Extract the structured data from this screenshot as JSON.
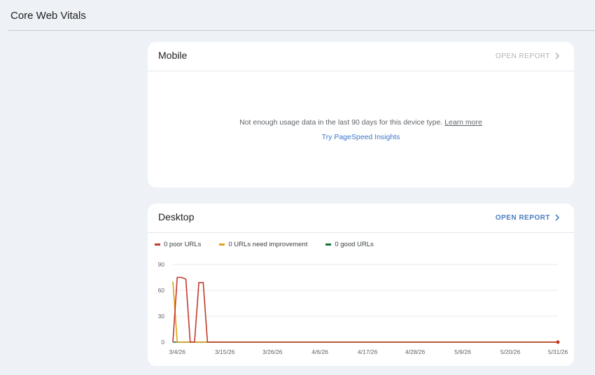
{
  "page": {
    "title": "Core Web Vitals"
  },
  "mobile": {
    "title": "Mobile",
    "open_report": "OPEN REPORT",
    "message": "Not enough usage data in the last 90 days for this device type.",
    "learn_more": "Learn more",
    "psi_link": "Try PageSpeed Insights"
  },
  "desktop": {
    "title": "Desktop",
    "open_report": "OPEN REPORT",
    "legend": {
      "poor": "0 poor URLs",
      "needs_improvement": "0 URLs need improvement",
      "good": "0 good URLs"
    }
  },
  "colors": {
    "poor": "#c0392b",
    "needs_improvement": "#e3a011",
    "good": "#137333",
    "link": "#4a7fc1"
  },
  "icons": {
    "open_report": "chevron-right-icon"
  },
  "chart_data": {
    "type": "line",
    "ylim": [
      0,
      90
    ],
    "yticks": [
      0,
      30,
      60,
      90
    ],
    "xrange": [
      "3/3/26",
      "5/31/26"
    ],
    "xtick_labels": [
      "3/4/26",
      "3/15/26",
      "3/26/26",
      "4/6/26",
      "4/17/26",
      "4/28/26",
      "5/9/26",
      "5/20/26",
      "5/31/26"
    ],
    "grid": true,
    "legend_position": "top-left",
    "series": [
      {
        "name": "0 poor URLs",
        "color": "#c0392b",
        "points": [
          [
            "3/3/26",
            0
          ],
          [
            "3/4/26",
            75
          ],
          [
            "3/5/26",
            75
          ],
          [
            "3/6/26",
            73
          ],
          [
            "3/7/26",
            0
          ],
          [
            "3/8/26",
            0
          ],
          [
            "3/9/26",
            69
          ],
          [
            "3/10/26",
            69
          ],
          [
            "3/11/26",
            0
          ],
          [
            "5/31/26",
            0
          ]
        ]
      },
      {
        "name": "0 URLs need improvement",
        "color": "#e3a011",
        "points": [
          [
            "3/3/26",
            70
          ],
          [
            "3/4/26",
            0
          ],
          [
            "5/31/26",
            0
          ]
        ]
      },
      {
        "name": "0 good URLs",
        "color": "#137333",
        "points": [
          [
            "3/3/26",
            0
          ],
          [
            "5/31/26",
            0
          ]
        ]
      }
    ],
    "end_marker": {
      "x": "5/31/26",
      "y": 0
    }
  }
}
